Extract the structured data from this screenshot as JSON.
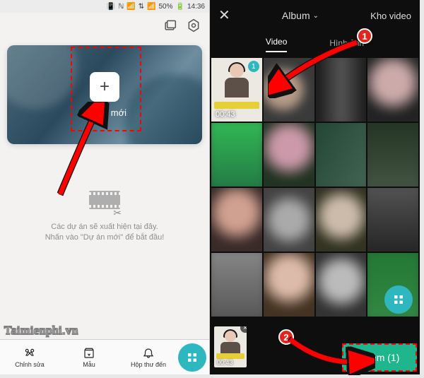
{
  "status": {
    "silent": "🔇",
    "nfc": "N",
    "wifi": "📶",
    "data": "D",
    "signal": "📶",
    "battery_pct": "50%",
    "time": "14:36"
  },
  "left": {
    "new_project_label": "Dự án mới",
    "empty_line1": "Các dự án sẽ xuất hiện tại đây.",
    "empty_line2": "Nhấn vào \"Dự án mới\" để bắt đầu!",
    "watermark": "Taimienphi.vn",
    "nav": {
      "edit": "Chỉnh sửa",
      "template": "Mẫu",
      "inbox": "Hộp thư đến"
    }
  },
  "right": {
    "album_label": "Album",
    "kho_video": "Kho video",
    "tab_video": "Video",
    "tab_image": "Hình ảnh",
    "selected_duration": "00:43",
    "selected_index": "1",
    "tray_duration": "00:43",
    "add_label": "Thêm (1)"
  },
  "badges": {
    "one": "1",
    "two": "2"
  }
}
